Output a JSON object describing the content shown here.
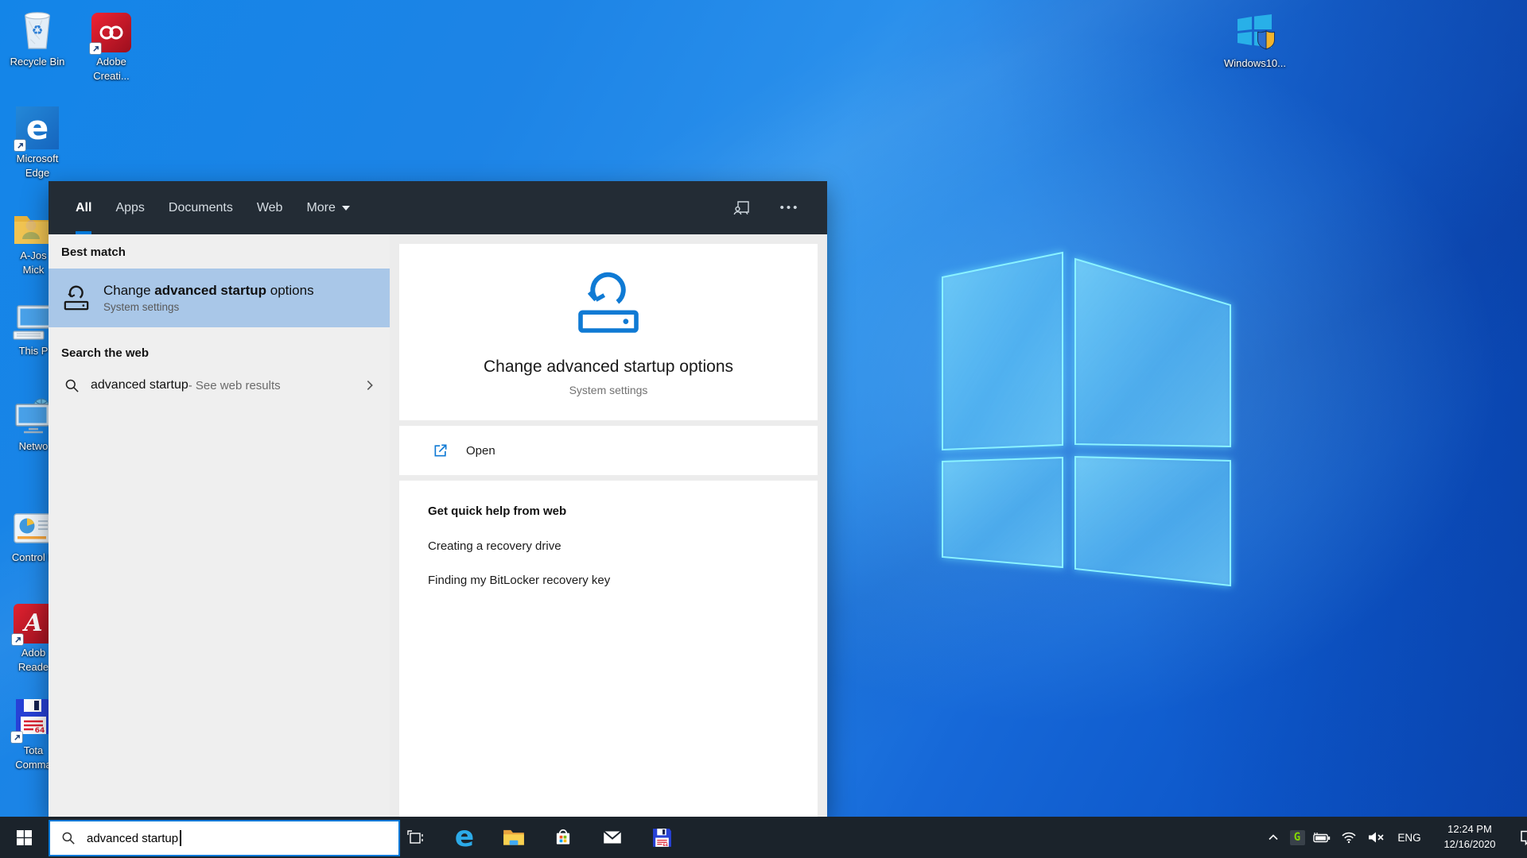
{
  "colors": {
    "accent_blue": "#0078d7",
    "taskbar_bg": "#1b232b",
    "panel_header_bg": "#232c35",
    "best_match_highlight": "#a9c7e8",
    "left_list_bg": "#efefef",
    "right_panel_bg": "#ececec",
    "hero_icon_blue": "#0f7ad4",
    "wallpaper_blue": "#1571dd"
  },
  "icon_names": {
    "header": [
      "feedback-icon",
      "more-options-ellipsis-icon"
    ],
    "taskbar": [
      "start-icon",
      "search-icon",
      "task-view-icon",
      "edge-icon",
      "file-explorer-icon",
      "store-icon",
      "mail-icon",
      "total-commander-icon"
    ],
    "tray": [
      "hidden-icons-chevron-icon",
      "greenshot-icon",
      "battery-icon",
      "wifi-icon",
      "volume-muted-icon",
      "action-center-icon"
    ]
  },
  "desktop": {
    "icons": {
      "recycle_bin": {
        "label": "Recycle Bin"
      },
      "adobe_creative_cloud": {
        "line1": "Adobe",
        "line2": "Creati..."
      },
      "microsoft_edge": {
        "line1": "Microsoft",
        "line2": "Edge"
      },
      "user_folder": {
        "line1": "A-Jos",
        "line2": "Mick"
      },
      "this_pc": {
        "label": "This P"
      },
      "network": {
        "label": "Netwo"
      },
      "control_panel": {
        "label": "Control P"
      },
      "adobe_reader": {
        "line1": "Adob",
        "line2": "Reade"
      },
      "total_commander": {
        "line1": "Tota",
        "line2": "Comma"
      },
      "windows10_setup": {
        "label": "Windows10..."
      }
    }
  },
  "search_panel": {
    "tabs": [
      "All",
      "Apps",
      "Documents",
      "Web",
      "More"
    ],
    "active_tab": "All",
    "left": {
      "best_match_header": "Best match",
      "best_match": {
        "title_prefix": "Change ",
        "title_bold": "advanced startup",
        "title_suffix": " options",
        "subtitle": "System settings"
      },
      "search_web_header": "Search the web",
      "web_suggestion": {
        "query": "advanced startup",
        "suffix": " - See web results"
      }
    },
    "right": {
      "hero_title": "Change advanced startup options",
      "hero_subtitle": "System settings",
      "open_label": "Open",
      "help_header": "Get quick help from web",
      "help_links": [
        "Creating a recovery drive",
        "Finding my BitLocker recovery key"
      ]
    }
  },
  "taskbar": {
    "search_value": "advanced startup",
    "tray": {
      "language": "ENG",
      "time": "12:24 PM",
      "date": "12/16/2020"
    }
  }
}
